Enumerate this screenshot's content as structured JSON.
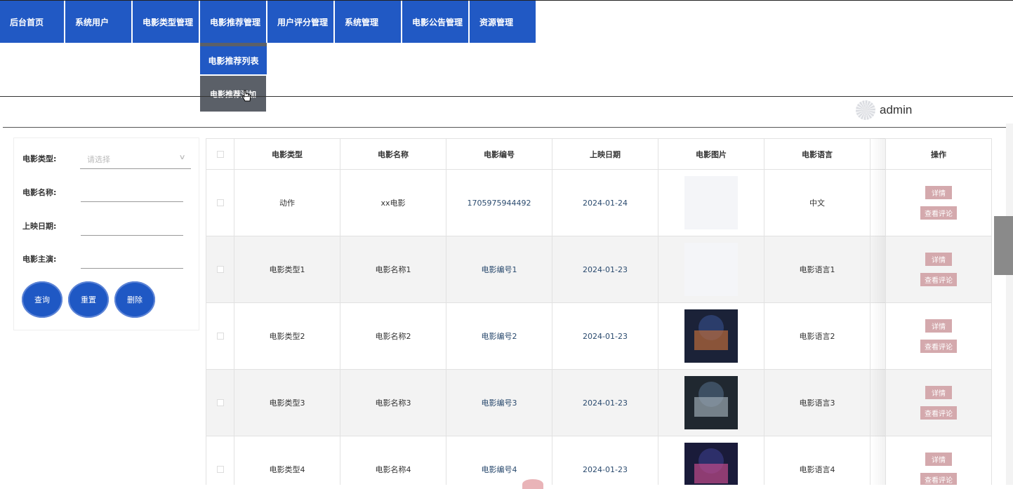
{
  "nav": {
    "items": [
      "后台首页",
      "系统用户",
      "电影类型管理",
      "电影推荐管理",
      "用户评分管理",
      "系统管理",
      "电影公告管理",
      "资源管理"
    ],
    "dropdown": [
      "电影推荐列表",
      "电影推荐添加"
    ]
  },
  "user": {
    "name": "admin"
  },
  "search": {
    "type_label": "电影类型:",
    "type_placeholder": "请选择",
    "name_label": "电影名称:",
    "date_label": "上映日期:",
    "actor_label": "电影主演:",
    "query": "查询",
    "reset": "重置",
    "delete": "删除"
  },
  "table": {
    "headers": [
      "电影类型",
      "电影名称",
      "电影编号",
      "上映日期",
      "电影图片",
      "电影语言",
      "操作"
    ],
    "rows": [
      {
        "type": "动作",
        "name": "xx电影",
        "code": "1705975944492",
        "date": "2024-01-24",
        "lang": "中文"
      },
      {
        "type": "电影类型1",
        "name": "电影名称1",
        "code": "电影编号1",
        "date": "2024-01-23",
        "lang": "电影语言1"
      },
      {
        "type": "电影类型2",
        "name": "电影名称2",
        "code": "电影编号2",
        "date": "2024-01-23",
        "lang": "电影语言2"
      },
      {
        "type": "电影类型3",
        "name": "电影名称3",
        "code": "电影编号3",
        "date": "2024-01-23",
        "lang": "电影语言3"
      },
      {
        "type": "电影类型4",
        "name": "电影名称4",
        "code": "电影编号4",
        "date": "2024-01-23",
        "lang": "电影语言4"
      }
    ],
    "detail": "详情",
    "review": "查看评论"
  },
  "colors": {
    "primary": "#2159c4",
    "dropdown_bg": "#5b6068",
    "action_btn": "#d4a9ad"
  }
}
